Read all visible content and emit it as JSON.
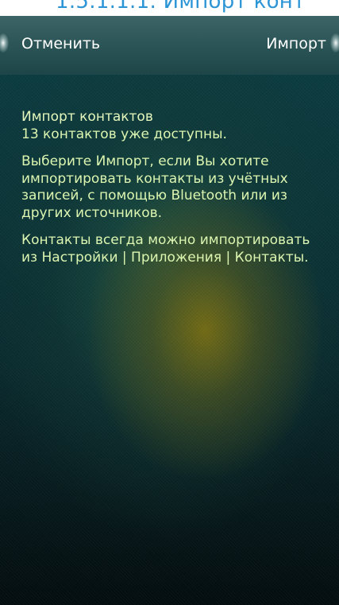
{
  "caption": {
    "text": "1.5.1.1.1. Импорт конт"
  },
  "action_bar": {
    "cancel_label": "Отменить",
    "import_label": "Импорт"
  },
  "content": {
    "title": "Импорт контактов",
    "subtitle": "13 контактов уже доступны.",
    "paragraph1": "Выберите Импорт, если Вы хотите импортировать контакты из учётных записей, с помощью Bluetooth или из других источников.",
    "paragraph2": "Контакты всегда можно импортировать из Настройки | Приложения | Контакты."
  },
  "colors": {
    "caption_text": "#2c95d6",
    "content_text": "#dcf5b0",
    "button_text": "#ffffff"
  }
}
